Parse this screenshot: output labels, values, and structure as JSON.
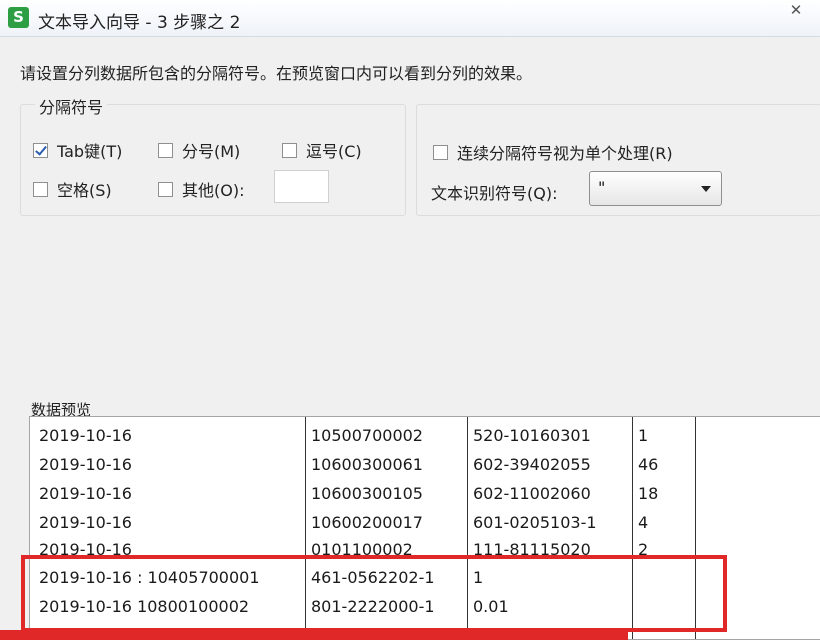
{
  "window": {
    "icon_letter": "S",
    "title": "文本导入向导 - 3 步骤之 2",
    "close_glyph": "✕"
  },
  "instruction": "请设置分列数据所包含的分隔符号。在预览窗口内可以看到分列的效果。",
  "delimiters": {
    "legend": "分隔符号",
    "tab": {
      "label": "Tab键(T)",
      "checked": true
    },
    "semicolon": {
      "label": "分号(M)",
      "checked": false
    },
    "comma": {
      "label": "逗号(C)",
      "checked": false
    },
    "space": {
      "label": "空格(S)",
      "checked": false
    },
    "other": {
      "label": "其他(O):",
      "checked": false,
      "value": ""
    }
  },
  "options": {
    "consecutive": {
      "label": "连续分隔符号视为单个处理(R)",
      "checked": false
    },
    "qualifier_label": "文本识别符号(Q):",
    "qualifier_value": "\""
  },
  "preview": {
    "label": "数据预览",
    "rows": [
      [
        "2019-10-16",
        "10500700002",
        "520-10160301",
        "1"
      ],
      [
        "2019-10-16",
        "10600300061",
        "602-39402055",
        "46"
      ],
      [
        "2019-10-16",
        "10600300105",
        "602-11002060",
        "18"
      ],
      [
        "2019-10-16",
        "10600200017",
        "601-0205103-1",
        "4"
      ],
      [
        "2019-10-16",
        "0101100002",
        "111-81115020",
        "2"
      ],
      [
        "2019-10-16 : 10405700001",
        "461-0562202-1",
        "1",
        ""
      ],
      [
        "2019-10-16 10800100002",
        "801-2222000-1",
        "0.01",
        ""
      ]
    ]
  },
  "colors": {
    "highlight": "#e02828",
    "app_icon": "#2e9e45"
  }
}
